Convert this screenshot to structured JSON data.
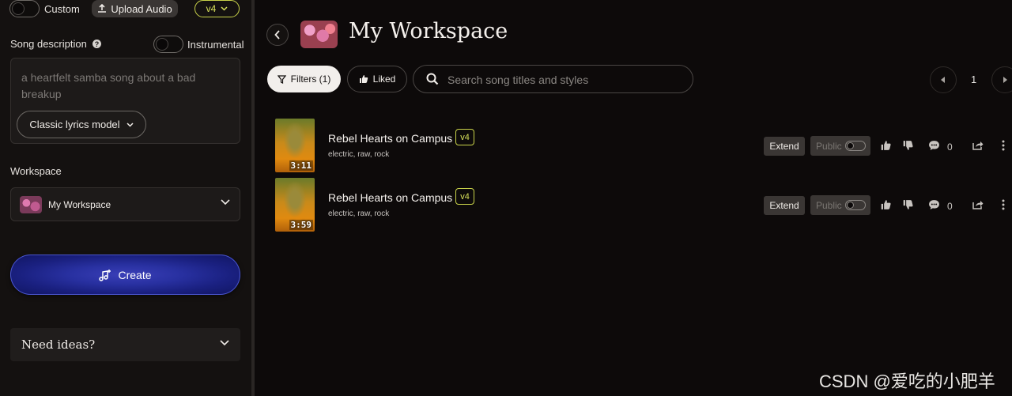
{
  "left": {
    "custom_label": "Custom",
    "upload_label": "Upload Audio",
    "version_label": "v4",
    "song_description_label": "Song description",
    "instrumental_label": "Instrumental",
    "description_placeholder": "a heartfelt samba song about a bad breakup",
    "lyrics_model_label": "Classic lyrics model",
    "workspace_label": "Workspace",
    "workspace_value": "My Workspace",
    "create_label": "Create",
    "ideas_label": "Need ideas?"
  },
  "main": {
    "title": "My Workspace",
    "filters_label": "Filters (1)",
    "liked_label": "Liked",
    "search_placeholder": "Search song titles and styles",
    "page_number": "1",
    "songs": [
      {
        "title": "Rebel Hearts on Campus",
        "version": "v4",
        "tags": "electric, raw, rock",
        "duration": "3:11",
        "extend_label": "Extend",
        "public_label": "Public",
        "comments": "0"
      },
      {
        "title": "Rebel Hearts on Campus",
        "version": "v4",
        "tags": "electric, raw, rock",
        "duration": "3:59",
        "extend_label": "Extend",
        "public_label": "Public",
        "comments": "0"
      }
    ]
  },
  "watermark": "CSDN @爱吃的小肥羊",
  "colors": {
    "accent_version": "#c9d34a",
    "create_button": "#2830a0",
    "background": "#0d0a0a",
    "panel": "#141110"
  },
  "icons": [
    "upload-icon",
    "chevron-down-icon",
    "help-icon",
    "music-plus-icon",
    "chevron-left-icon",
    "chevron-right-icon",
    "filter-icon",
    "thumbs-up-icon",
    "thumbs-down-icon",
    "search-icon",
    "comment-icon",
    "share-icon",
    "more-vertical-icon"
  ]
}
